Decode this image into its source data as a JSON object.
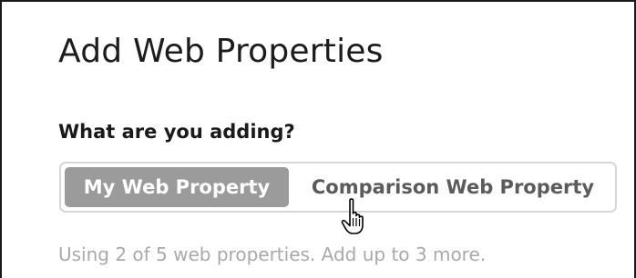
{
  "dialog": {
    "title": "Add Web Properties",
    "question": "What are you adding?",
    "options": [
      {
        "label": "My Web Property",
        "selected": true
      },
      {
        "label": "Comparison Web Property",
        "selected": false
      }
    ],
    "usage_text": "Using 2 of 5 web properties. Add up to 3 more.",
    "cursor_icon": "hand-pointer-icon"
  },
  "colors": {
    "selected_bg": "#9b9b9b",
    "unselected_text": "#5b5b5b",
    "hint_text": "#a9a9a9",
    "border": "#d6d6d6"
  }
}
